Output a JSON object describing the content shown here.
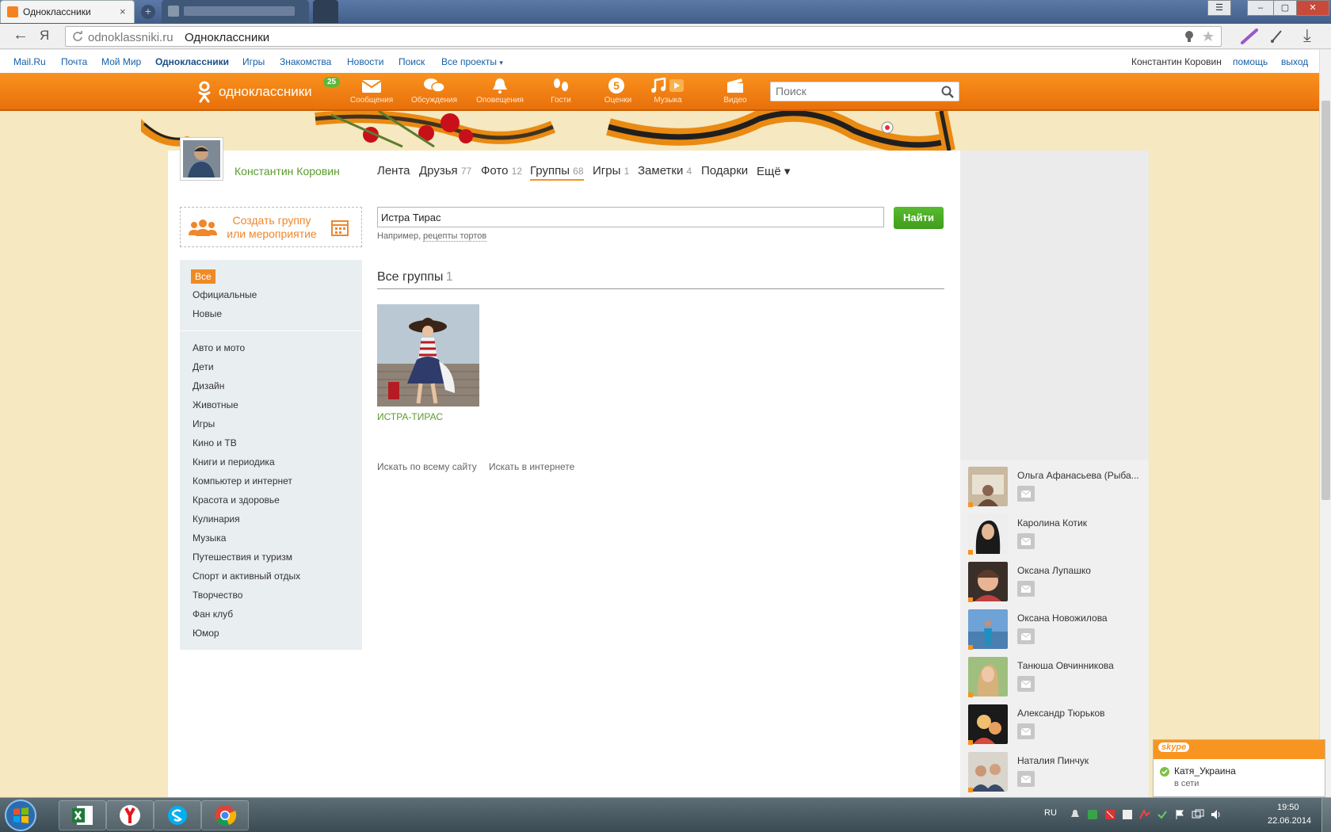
{
  "browser": {
    "tab_title": "Одноклассники",
    "close_glyph": "×",
    "new_tab_glyph": "+",
    "back_glyph": "←",
    "yandex_glyph": "Я",
    "url_domain": "odnoklassniki.ru",
    "url_title": "Одноклассники",
    "download_glyph": "⤓",
    "window_buttons": [
      "☰",
      "–",
      "▢",
      "✕"
    ]
  },
  "portal": {
    "links": [
      "Mail.Ru",
      "Почта",
      "Мой Мир",
      "Одноклассники",
      "Игры",
      "Знакомства",
      "Новости",
      "Поиск",
      "Все проекты"
    ],
    "user": "Константин Коровин",
    "help": "помощь",
    "logout": "выход"
  },
  "header": {
    "logo_text": "одноклассники",
    "logo_badge": "25",
    "nav": [
      {
        "label": "Сообщения",
        "icon": "envelope-icon"
      },
      {
        "label": "Обсуждения",
        "icon": "speech-bubbles-icon"
      },
      {
        "label": "Оповещения",
        "icon": "bell-icon"
      },
      {
        "label": "Гости",
        "icon": "footprints-icon"
      },
      {
        "label": "Оценки",
        "icon": "rating-five-icon"
      },
      {
        "label": "Музыка",
        "icon": "music-note-icon"
      },
      {
        "label": "Видео",
        "icon": "clapperboard-icon"
      }
    ],
    "rating_digit": "5",
    "search_placeholder": "Поиск"
  },
  "profile": {
    "name": "Константин Коровин",
    "tabs": [
      {
        "label": "Лента",
        "count": ""
      },
      {
        "label": "Друзья",
        "count": "77"
      },
      {
        "label": "Фото",
        "count": "12"
      },
      {
        "label": "Группы",
        "count": "68"
      },
      {
        "label": "Игры",
        "count": "1"
      },
      {
        "label": "Заметки",
        "count": "4"
      },
      {
        "label": "Подарки",
        "count": ""
      },
      {
        "label": "Ещё ▾",
        "count": ""
      }
    ]
  },
  "create_group": {
    "line1": "Создать группу",
    "line2": "или мероприятие"
  },
  "search_form": {
    "query": "Истра Тирас",
    "button": "Найти",
    "hint_prefix": "Например,",
    "hint_link": "рецепты тортов"
  },
  "filters": {
    "top": [
      "Все",
      "Официальные",
      "Новые"
    ],
    "categories": [
      "Авто и мото",
      "Дети",
      "Дизайн",
      "Животные",
      "Игры",
      "Кино и ТВ",
      "Книги и периодика",
      "Компьютер и интернет",
      "Красота и здоровье",
      "Кулинария",
      "Музыка",
      "Путешествия и туризм",
      "Спорт и активный отдых",
      "Творчество",
      "Фан клуб",
      "Юмор"
    ]
  },
  "results": {
    "heading": "Все группы",
    "count": "1",
    "groups": [
      {
        "name": "ИСТРА-ТИРАС"
      }
    ],
    "search_site": "Искать по всему сайту",
    "search_web": "Искать в интернете"
  },
  "friends": [
    {
      "name": "Ольга Афанасьева (Рыба..."
    },
    {
      "name": "Каролина Котик"
    },
    {
      "name": "Оксана Лупашко"
    },
    {
      "name": "Оксана Новожилова"
    },
    {
      "name": "Танюша Овчинникова"
    },
    {
      "name": "Александр Тюрьков"
    },
    {
      "name": "Наталия Пинчук"
    }
  ],
  "skype": {
    "brand": "skype",
    "contact": "Катя_Украина",
    "status": "в сети"
  },
  "taskbar": {
    "lang": "RU",
    "time": "19:50",
    "date": "22.06.2014",
    "apps": [
      "excel-icon",
      "yandex-browser-icon",
      "skype-icon",
      "chrome-icon"
    ]
  },
  "colors": {
    "ok_orange": "#f7931e",
    "ok_green": "#4bae1e",
    "link_green": "#5a9b2e"
  }
}
